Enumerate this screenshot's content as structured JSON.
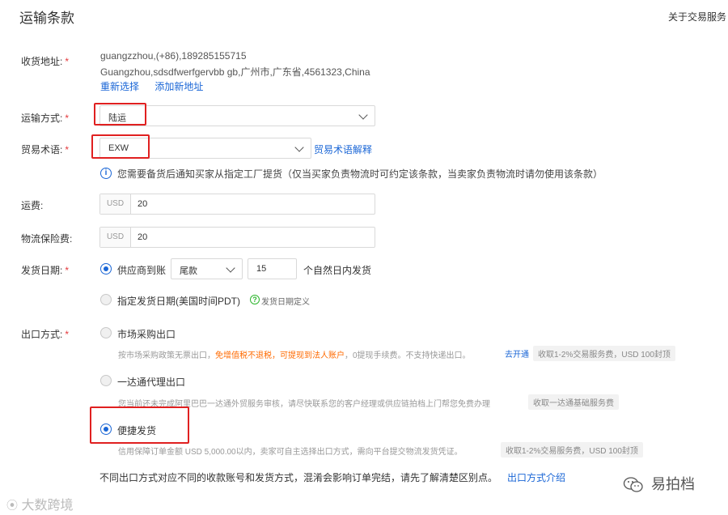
{
  "header": {
    "title": "运输条款",
    "right_link": "关于交易服务"
  },
  "address": {
    "label": "收货地址:",
    "required": "*",
    "line1": "guangzzhou,(+86),189285155715",
    "line2": "Guangzhou,sdsdfwerfgervbb gb,广州市,广东省,4561323,China",
    "reselect": "重新选择",
    "add_new": "添加新地址"
  },
  "shipping_method": {
    "label": "运输方式:",
    "required": "*",
    "value": "陆运"
  },
  "trade_term": {
    "label": "贸易术语:",
    "required": "*",
    "value": "EXW",
    "explain_link": "贸易术语解释",
    "info": "您需要备货后通知买家从指定工厂提货（仅当买家负责物流时可约定该条款，当卖家负责物流时请勿使用该条款）"
  },
  "freight": {
    "label": "运费:",
    "currency": "USD",
    "value": "20"
  },
  "insurance": {
    "label": "物流保险费:",
    "currency": "USD",
    "value": "20"
  },
  "ship_date": {
    "label": "发货日期:",
    "required": "*",
    "option1_label": "供应商到账",
    "option1_select": "尾款",
    "option1_days": "15",
    "option1_suffix": "个自然日内发货",
    "option2_label": "指定发货日期(美国时间PDT)",
    "option2_help": "发货日期定义"
  },
  "export_method": {
    "label": "出口方式:",
    "required": "*",
    "market": {
      "label": "市场采购出口",
      "desc_a": "按市场采购政策无票出口，",
      "desc_b": "免增值税不退税，可提现到法人账户",
      "desc_c": "，0提现手续费。不支持快递出口。",
      "open_link": "去开通",
      "tag": "收取1-2%交易服务费，USD 100封顶"
    },
    "onetouch": {
      "label": "一达通代理出口",
      "desc": "您当前还未完成阿里巴巴一达通外贸服务审核，请尽快联系您的客户经理或供应链拍档上门帮您免费办理",
      "tag": "收取一达通基础服务费"
    },
    "express": {
      "label": "便捷发货",
      "desc": "信用保障订单金额 USD 5,000.00以内，卖家可自主选择出口方式，需向平台提交物流发货凭证。",
      "tag": "收取1-2%交易服务费，USD 100封顶"
    }
  },
  "footer": {
    "note": "不同出口方式对应不同的收款账号和发货方式，混淆会影响订单完结，请先了解清楚区别点。",
    "link": "出口方式介绍"
  },
  "watermarks": {
    "right": "易拍档",
    "left": "大数跨境"
  },
  "colors": {
    "link": "#1a66d6",
    "required": "#e4393c",
    "highlight_box": "#e02020",
    "orange": "#ff6a00"
  }
}
